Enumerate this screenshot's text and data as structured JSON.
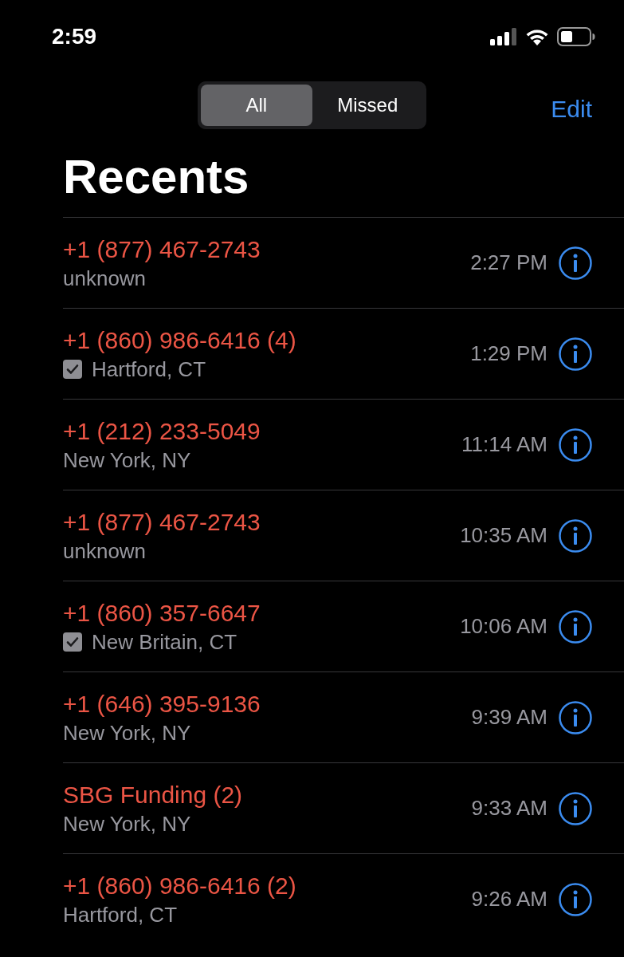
{
  "status_bar": {
    "time": "2:59"
  },
  "segments": [
    {
      "label": "All",
      "selected": true
    },
    {
      "label": "Missed",
      "selected": false
    }
  ],
  "edit_button": "Edit",
  "title": "Recents",
  "calls": [
    {
      "caller": "+1 (877) 467-2743",
      "detail": "unknown",
      "verified": false,
      "time": "2:27 PM"
    },
    {
      "caller": "+1 (860) 986-6416 (4)",
      "detail": "Hartford, CT",
      "verified": true,
      "time": "1:29 PM"
    },
    {
      "caller": "+1 (212) 233-5049",
      "detail": "New York, NY",
      "verified": false,
      "time": "11:14 AM"
    },
    {
      "caller": "+1 (877) 467-2743",
      "detail": "unknown",
      "verified": false,
      "time": "10:35 AM"
    },
    {
      "caller": "+1 (860) 357-6647",
      "detail": "New Britain, CT",
      "verified": true,
      "time": "10:06 AM"
    },
    {
      "caller": "+1 (646) 395-9136",
      "detail": "New York, NY",
      "verified": false,
      "time": "9:39 AM"
    },
    {
      "caller": "SBG Funding (2)",
      "detail": "New York, NY",
      "verified": false,
      "time": "9:33 AM"
    },
    {
      "caller": "+1 (860) 986-6416 (2)",
      "detail": "Hartford, CT",
      "verified": false,
      "time": "9:26 AM"
    }
  ]
}
